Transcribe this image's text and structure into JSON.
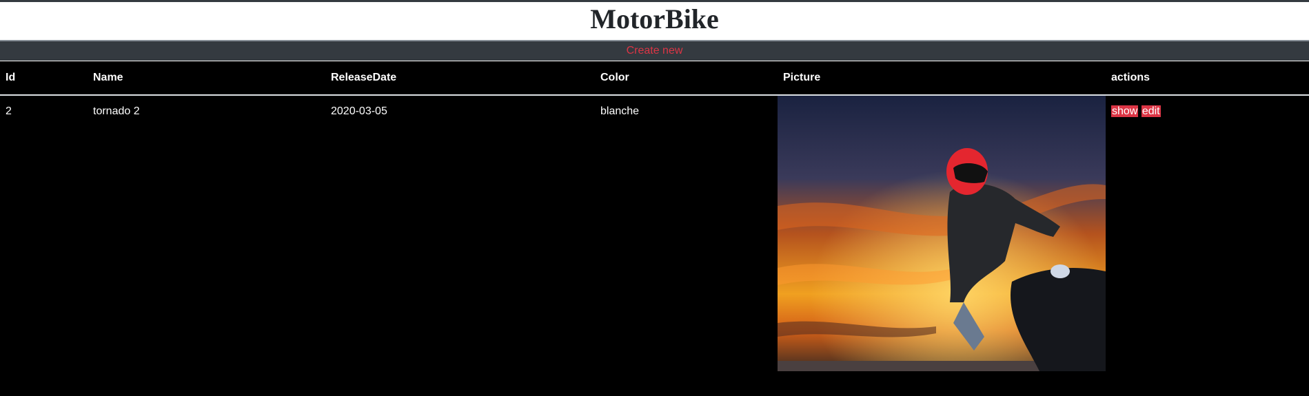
{
  "header": {
    "title": "MotorBike"
  },
  "nav": {
    "create_label": "Create new"
  },
  "table": {
    "columns": [
      "Id",
      "Name",
      "ReleaseDate",
      "Color",
      "Picture",
      "actions"
    ],
    "rows": [
      {
        "id": "2",
        "name": "tornado 2",
        "release_date": "2020-03-05",
        "color": "blanche",
        "picture_alt": "motorbike rider at sunset",
        "actions": {
          "show": "show",
          "edit": "edit"
        }
      }
    ]
  },
  "colors": {
    "header_bg": "#ffffff",
    "nav_bg": "#343a40",
    "accent": "#dc3545",
    "table_bg": "#000000"
  }
}
